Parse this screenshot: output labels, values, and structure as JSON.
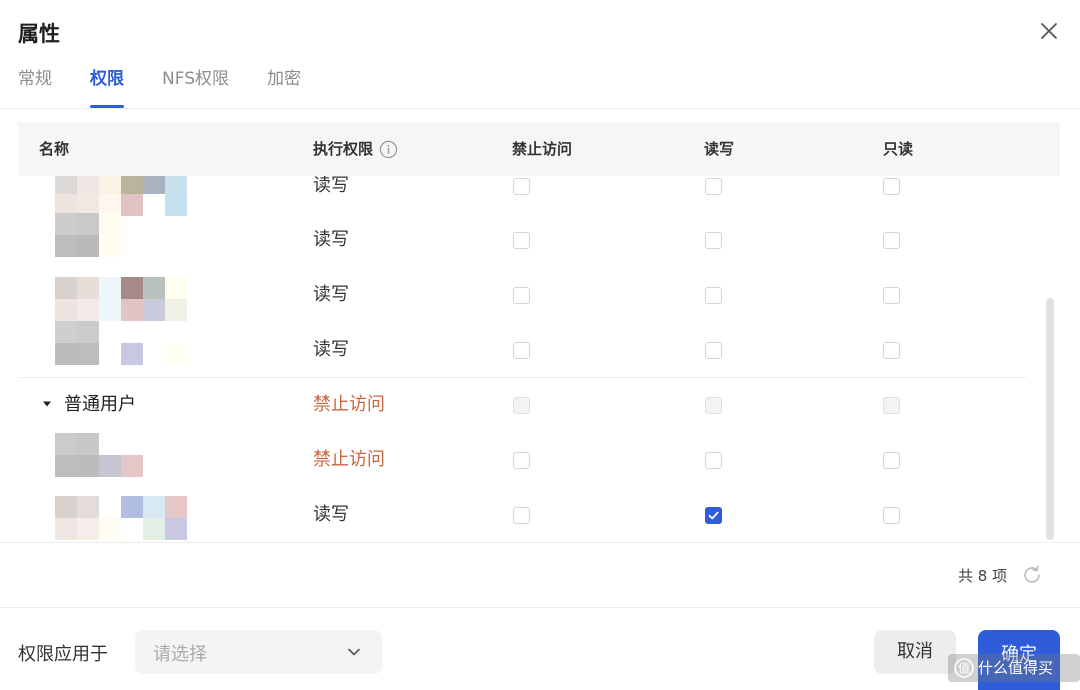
{
  "dialog": {
    "title": "属性"
  },
  "tabs": [
    {
      "label": "常规",
      "active": false
    },
    {
      "label": "权限",
      "active": true
    },
    {
      "label": "NFS权限",
      "active": false
    },
    {
      "label": "加密",
      "active": false
    }
  ],
  "table": {
    "headers": {
      "name": "名称",
      "exec": "执行权限",
      "deny": "禁止访问",
      "rw": "读写",
      "ro": "只读"
    },
    "rows": [
      {
        "type": "user",
        "permission": "读写",
        "deny": false,
        "rw": false,
        "ro": false
      },
      {
        "type": "user",
        "permission": "读写",
        "deny": false,
        "rw": false,
        "ro": false
      },
      {
        "type": "user",
        "permission": "读写",
        "deny": false,
        "rw": false,
        "ro": false
      },
      {
        "type": "user",
        "permission": "读写",
        "deny": false,
        "rw": false,
        "ro": false
      },
      {
        "type": "group",
        "label": "普通用户",
        "permission": "禁止访问",
        "deny": false,
        "rw": false,
        "ro": false
      },
      {
        "type": "user",
        "permission": "禁止访问",
        "deny": false,
        "rw": false,
        "ro": false
      },
      {
        "type": "user",
        "permission": "读写",
        "deny": false,
        "rw": true,
        "ro": false
      }
    ]
  },
  "footer": {
    "total_label": "共 8 项",
    "apply_label": "权限应用于",
    "select_placeholder": "请选择",
    "cancel_label": "取消",
    "confirm_label": "确定",
    "watermark_text": "什么值得买"
  },
  "colors": {
    "accent": "#2f5cd9",
    "deny_text": "#c9663f"
  }
}
